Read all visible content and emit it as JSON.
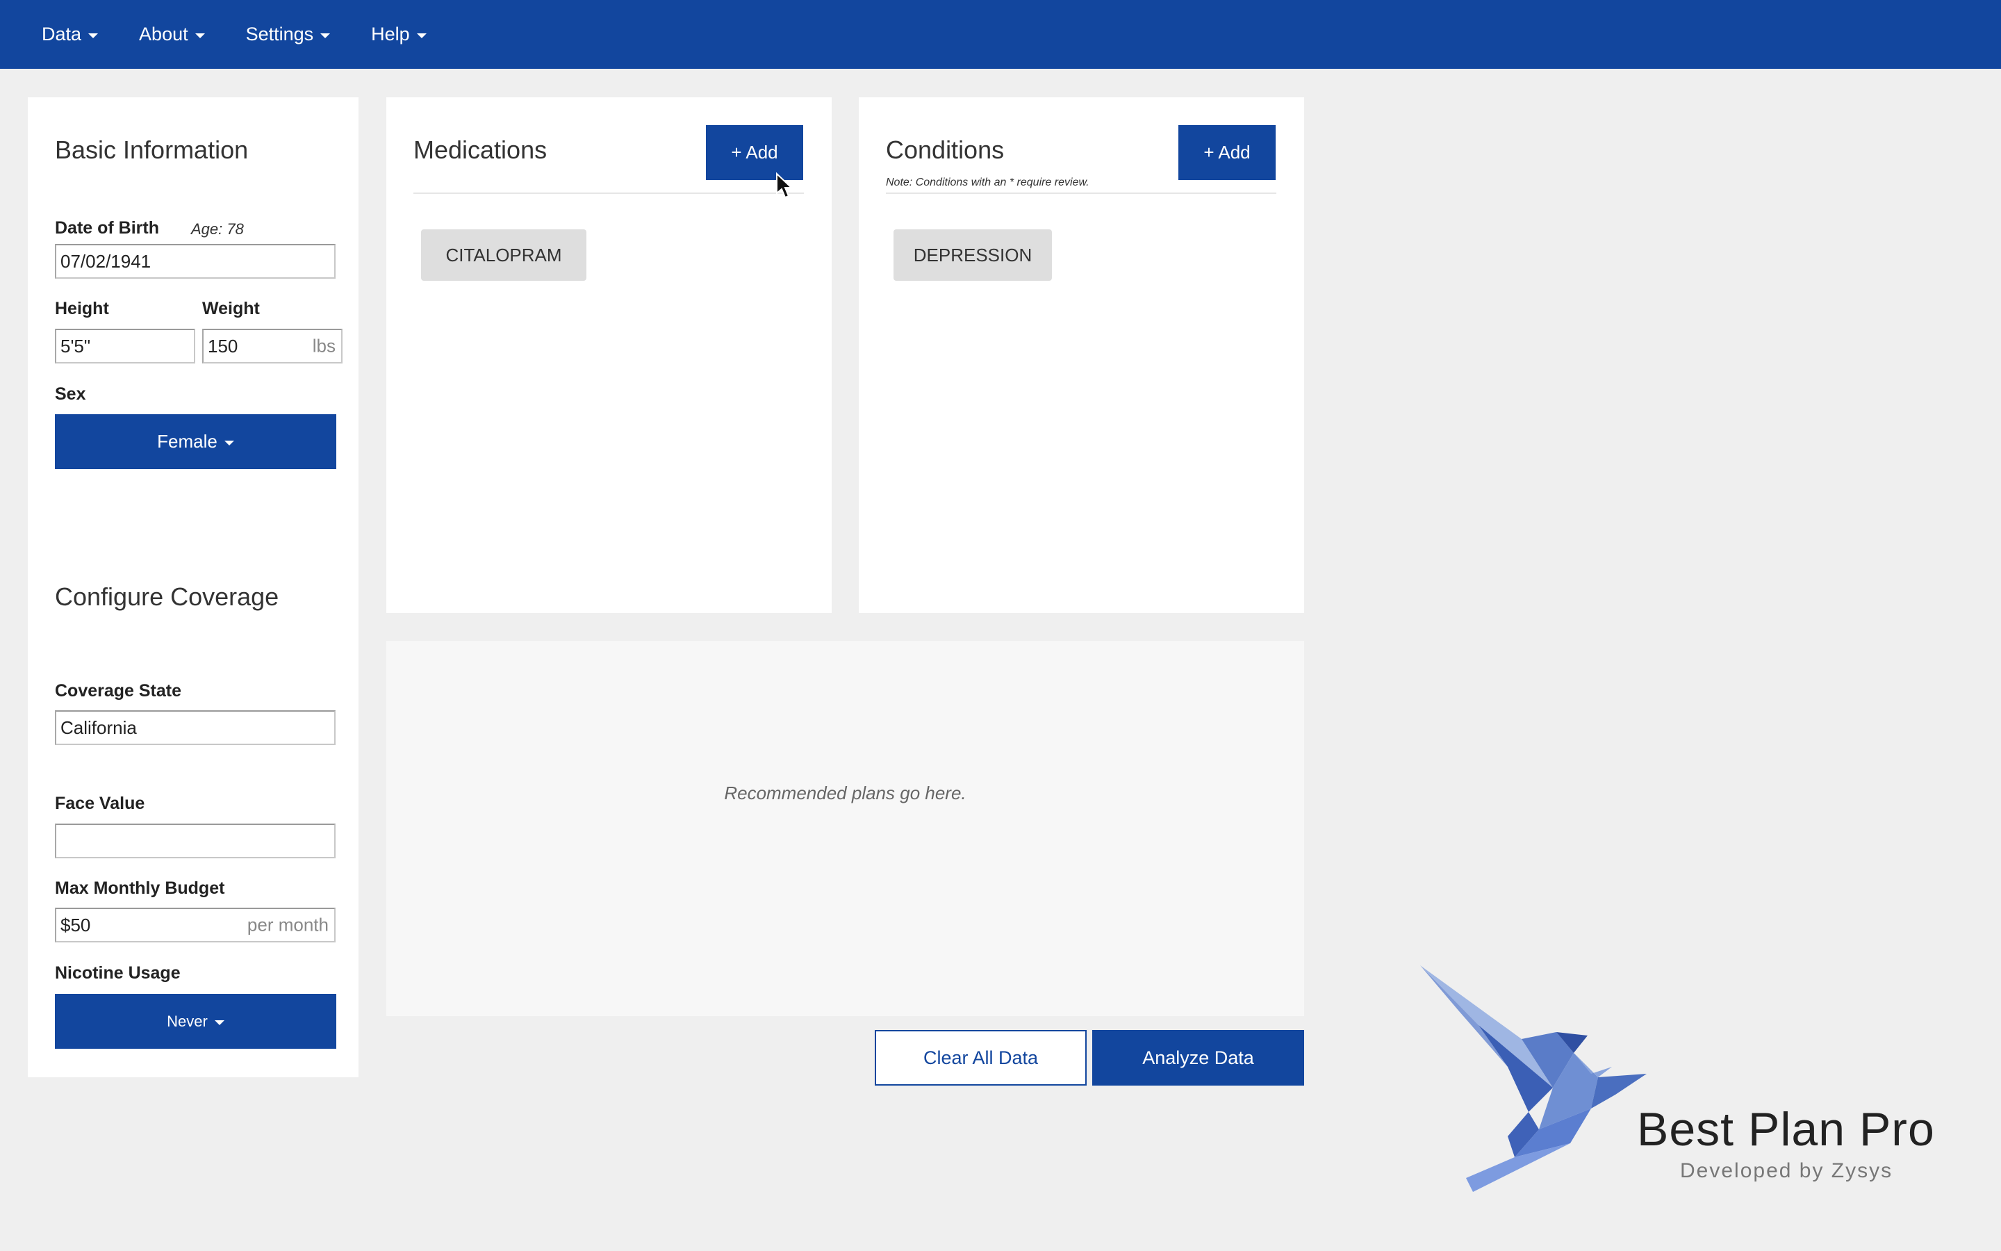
{
  "nav": {
    "items": [
      "Data",
      "About",
      "Settings",
      "Help"
    ]
  },
  "basic_info": {
    "title": "Basic Information",
    "dob_label": "Date of Birth",
    "age_label": "Age: 78",
    "dob_value": "07/02/1941",
    "height_label": "Height",
    "height_value": "5'5\"",
    "weight_label": "Weight",
    "weight_value": "150",
    "weight_unit": "lbs",
    "sex_label": "Sex",
    "sex_value": "Female"
  },
  "coverage": {
    "title": "Configure Coverage",
    "state_label": "Coverage State",
    "state_value": "California",
    "face_label": "Face Value",
    "face_value": "",
    "budget_label": "Max Monthly Budget",
    "budget_value": "$50",
    "budget_unit": "per month",
    "nicotine_label": "Nicotine Usage",
    "nicotine_value": "Never"
  },
  "medications": {
    "title": "Medications",
    "add_label": "+ Add",
    "items": [
      "CITALOPRAM"
    ]
  },
  "conditions": {
    "title": "Conditions",
    "add_label": "+ Add",
    "note": "Note: Conditions with an * require review.",
    "items": [
      "DEPRESSION"
    ]
  },
  "recommendations": {
    "placeholder": "Recommended plans go here."
  },
  "actions": {
    "clear_label": "Clear All Data",
    "analyze_label": "Analyze Data"
  },
  "brand": {
    "name": "Best Plan Pro",
    "sub": "Developed by Zysys"
  },
  "colors": {
    "primary": "#12469e",
    "background": "#efefef",
    "chip": "#dedede"
  },
  "icons": {
    "logo": "origami-bird-logo",
    "cursor": "mouse-pointer-icon"
  }
}
